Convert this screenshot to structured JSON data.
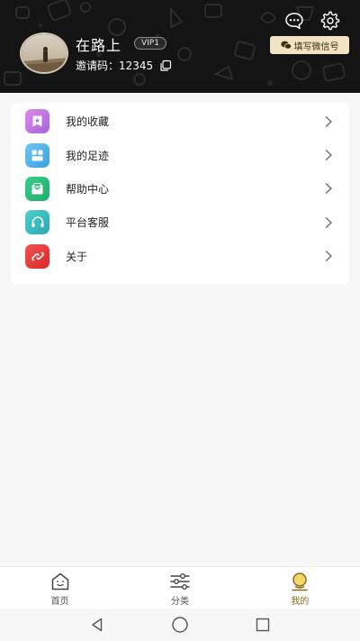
{
  "header": {
    "username": "在路上",
    "vip_label": "VIP1",
    "invite_text": "邀请码：12345",
    "wechat_button": "填写微信号",
    "icons": [
      "message-icon",
      "settings-icon",
      "copy-icon",
      "wechat-icon"
    ]
  },
  "menu": {
    "items": [
      {
        "label": "我的收藏",
        "icon": "favorite-icon",
        "color": "#c86fe0"
      },
      {
        "label": "我的足迹",
        "icon": "footprint-icon",
        "color": "#4fb7ec"
      },
      {
        "label": "帮助中心",
        "icon": "help-icon",
        "color": "#2bc07a"
      },
      {
        "label": "平台客服",
        "icon": "headset-icon",
        "color": "#36c0c0"
      },
      {
        "label": "关于",
        "icon": "about-icon",
        "color": "#ee3a3a"
      }
    ]
  },
  "tabbar": {
    "tabs": [
      {
        "label": "首页",
        "icon": "home-icon",
        "active": false
      },
      {
        "label": "分类",
        "icon": "category-icon",
        "active": false
      },
      {
        "label": "我的",
        "icon": "profile-icon",
        "active": true
      }
    ],
    "active_color": "#8a6d1f"
  },
  "system_nav": [
    "back-icon",
    "home-circle-icon",
    "recents-icon"
  ]
}
